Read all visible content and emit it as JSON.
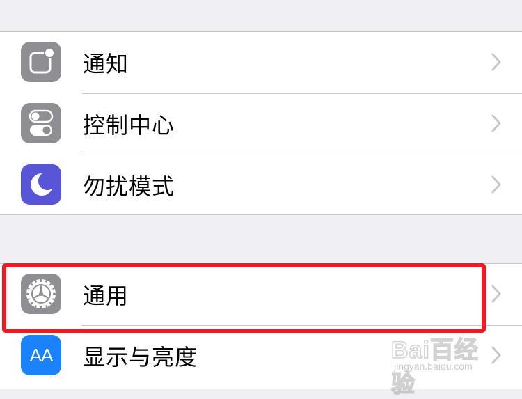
{
  "groups": [
    {
      "items": [
        {
          "label": "通知",
          "icon": "notifications-icon",
          "icon_color": "#8e8e93"
        },
        {
          "label": "控制中心",
          "icon": "control-center-icon",
          "icon_color": "#8e8e93"
        },
        {
          "label": "勿扰模式",
          "icon": "moon-icon",
          "icon_color": "#5856d6"
        }
      ]
    },
    {
      "items": [
        {
          "label": "通用",
          "icon": "gear-icon",
          "icon_color": "#8e8e93",
          "highlighted": true
        },
        {
          "label": "显示与亮度",
          "icon": "text-size-icon",
          "icon_color": "#1a82fb",
          "icon_text": "AA"
        }
      ]
    }
  ],
  "colors": {
    "background": "#efeff4",
    "separator": "#c8c7cc",
    "chevron": "#c7c7cc",
    "highlight": "#ed1c24"
  },
  "watermark": {
    "brand": "Bai百经验",
    "url": "jingyan.baidu.com"
  }
}
